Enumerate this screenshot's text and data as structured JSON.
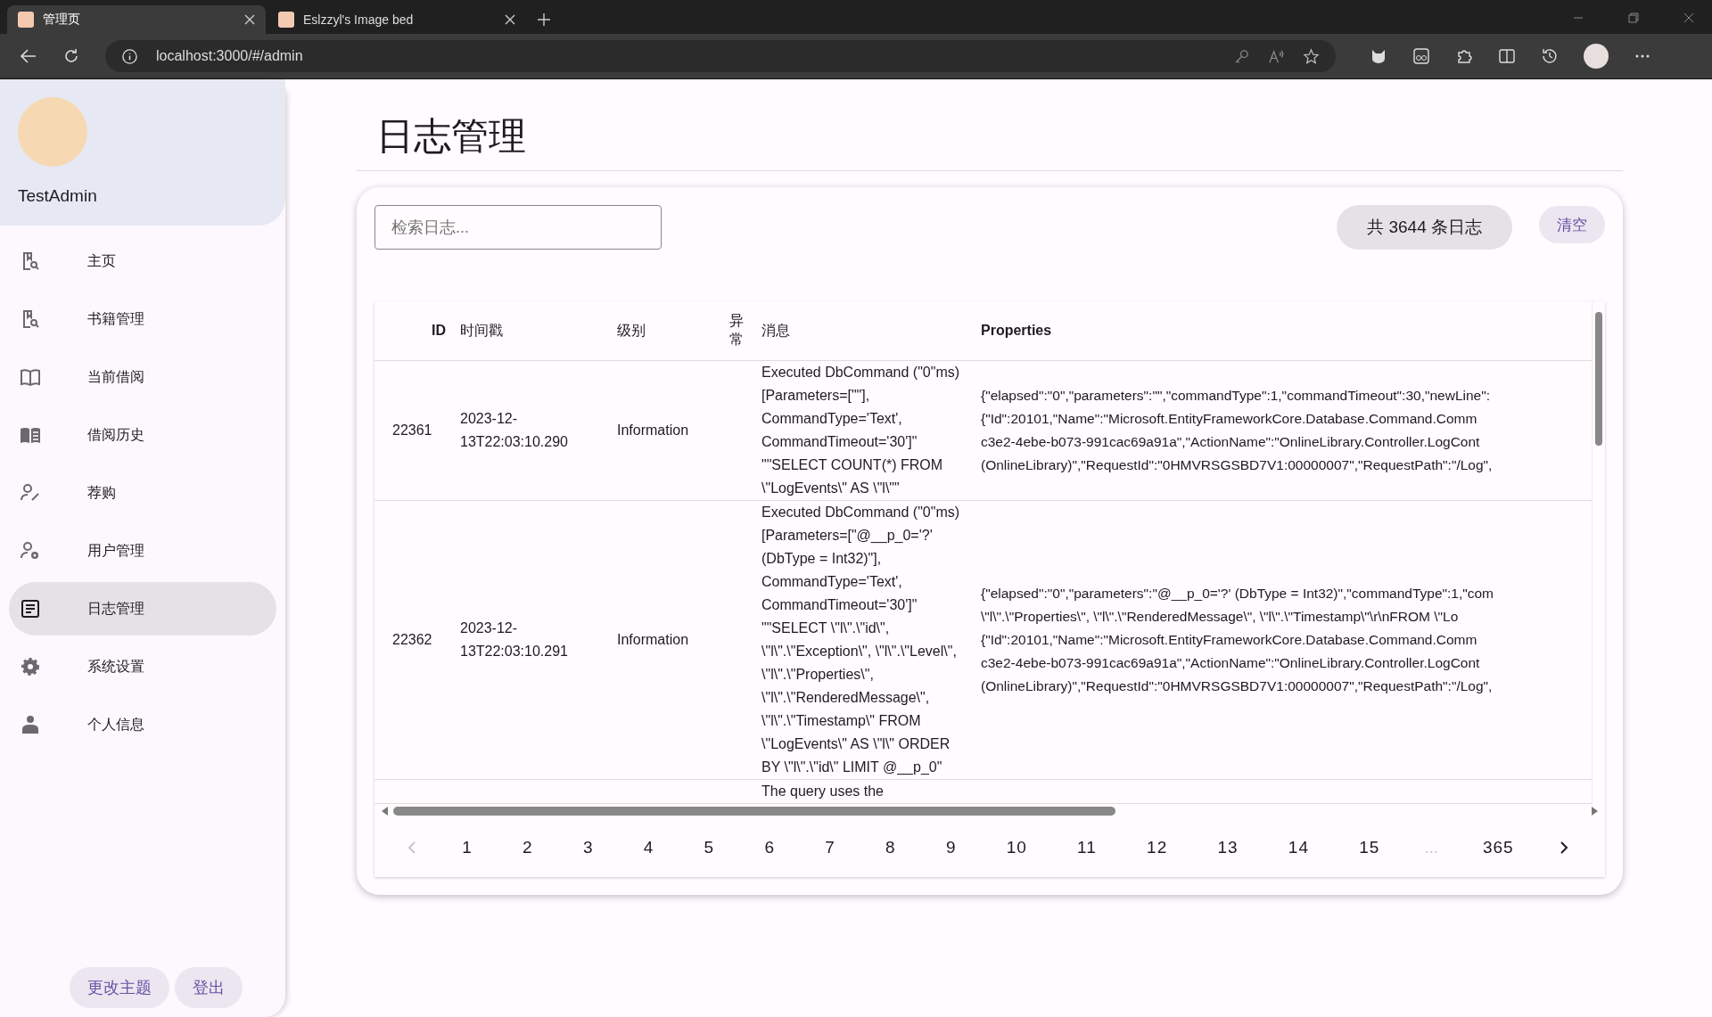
{
  "browser": {
    "tabs": [
      {
        "title": "管理页",
        "selected": true
      },
      {
        "title": "Eslzzyl's Image bed",
        "selected": false
      }
    ],
    "url": "localhost:3000/#/admin"
  },
  "sidebar": {
    "user": "TestAdmin",
    "items": [
      {
        "label": "主页",
        "selected": false
      },
      {
        "label": "书籍管理",
        "selected": false
      },
      {
        "label": "当前借阅",
        "selected": false
      },
      {
        "label": "借阅历史",
        "selected": false
      },
      {
        "label": "荐购",
        "selected": false
      },
      {
        "label": "用户管理",
        "selected": false
      },
      {
        "label": "日志管理",
        "selected": true
      },
      {
        "label": "系统设置",
        "selected": false
      },
      {
        "label": "个人信息",
        "selected": false
      }
    ],
    "buttons": [
      "更改主题",
      "登出"
    ]
  },
  "page_title": "日志管理",
  "search": {
    "placeholder": "检索日志..."
  },
  "count_chip": "共 3644 条日志",
  "clear_button": "清空",
  "table": {
    "columns": [
      "ID",
      "时间戳",
      "级别",
      "异常",
      "消息",
      "Properties"
    ],
    "rows": [
      {
        "id": "22361",
        "timestamp": "2023-12-13T22:03:10.290",
        "level": "Information",
        "message": "Executed DbCommand (\"0\"ms) [Parameters=[\"\"], CommandType='Text', CommandTimeout='30']\" \"\"SELECT COUNT(*) FROM \\\"LogEvents\\\" AS \\\"l\\\"\"",
        "properties": [
          "{\"elapsed\":\"0\",\"parameters\":\"\",\"commandType\":1,\"commandTimeout\":30,\"newLine\":",
          "{\"Id\":20101,\"Name\":\"Microsoft.EntityFrameworkCore.Database.Command.Comm",
          "c3e2-4ebe-b073-991cac69a91a\",\"ActionName\":\"OnlineLibrary.Controller.LogCont",
          "(OnlineLibrary)\",\"RequestId\":\"0HMVRSGSBD7V1:00000007\",\"RequestPath\":\"/Log\","
        ]
      },
      {
        "id": "22362",
        "timestamp": "2023-12-13T22:03:10.291",
        "level": "Information",
        "message": "Executed DbCommand (\"0\"ms) [Parameters=[\"@__p_0='?' (DbType = Int32)\"], CommandType='Text', CommandTimeout='30']\" \"\"SELECT \\\"l\\\".\\\"id\\\", \\\"l\\\".\\\"Exception\\\", \\\"l\\\".\\\"Level\\\", \\\"l\\\".\\\"Properties\\\", \\\"l\\\".\\\"RenderedMessage\\\", \\\"l\\\".\\\"Timestamp\\\" FROM \\\"LogEvents\\\" AS \\\"l\\\" ORDER BY \\\"l\\\".\\\"id\\\" LIMIT @__p_0\"",
        "properties": [
          "{\"elapsed\":\"0\",\"parameters\":\"@__p_0='?' (DbType = Int32)\",\"commandType\":1,\"com",
          "\\\"l\\\".\\\"Properties\\\", \\\"l\\\".\\\"RenderedMessage\\\", \\\"l\\\".\\\"Timestamp\\\"\\r\\nFROM \\\"Lo",
          "{\"Id\":20101,\"Name\":\"Microsoft.EntityFrameworkCore.Database.Command.Comm",
          "c3e2-4ebe-b073-991cac69a91a\",\"ActionName\":\"OnlineLibrary.Controller.LogCont",
          "(OnlineLibrary)\",\"RequestId\":\"0HMVRSGSBD7V1:00000007\",\"RequestPath\":\"/Log\","
        ]
      },
      {
        "id": "",
        "timestamp": "",
        "level": "",
        "message": "The query uses the",
        "properties": []
      }
    ]
  },
  "pagination": {
    "prev_disabled": true,
    "pages": [
      "1",
      "2",
      "3",
      "4",
      "5",
      "6",
      "7",
      "8",
      "9",
      "10",
      "11",
      "12",
      "13",
      "14",
      "15"
    ],
    "ellipsis": "...",
    "last": "365",
    "next_disabled": false
  }
}
